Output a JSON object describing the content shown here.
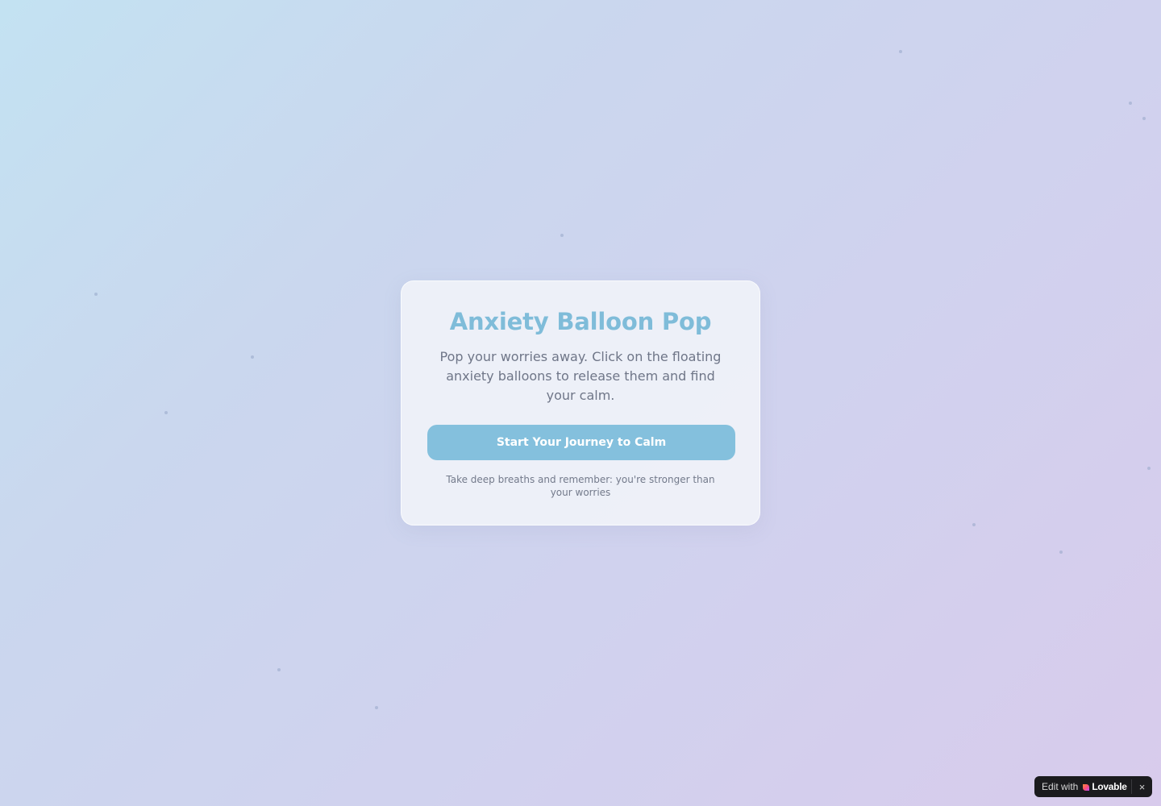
{
  "card": {
    "title": "Anxiety Balloon Pop",
    "subtitle": "Pop your worries away. Click on the floating anxiety balloons to release them and find your calm.",
    "start_button_label": "Start Your Journey to Calm",
    "footnote": "Take deep breaths and remember: you're stronger than your worries"
  },
  "badge": {
    "prefix": "Edit with",
    "brand": "Lovable",
    "close_label": "×",
    "heart_icon": "heart-icon",
    "close_icon": "close-icon"
  },
  "colors": {
    "title": "#7fbcd9",
    "button": "#84c0dd",
    "brand_heart": "#ff5a6e"
  }
}
